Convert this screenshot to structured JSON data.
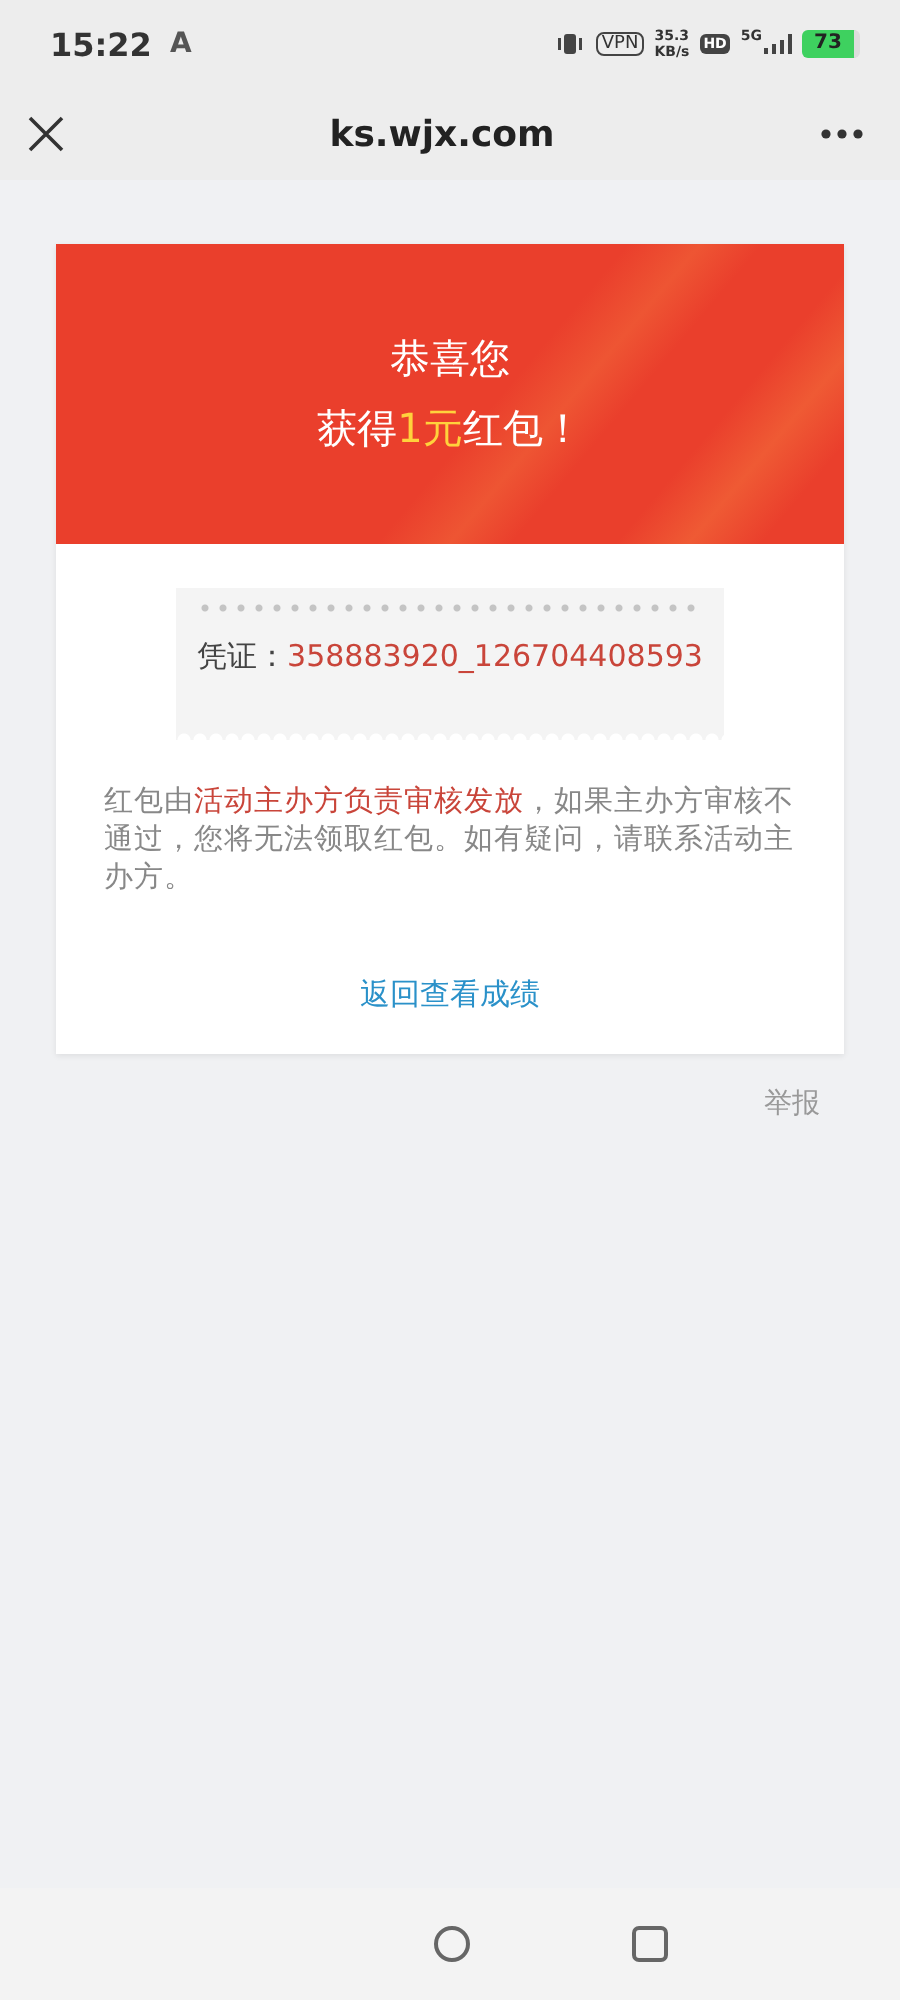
{
  "status_bar": {
    "time": "15:22",
    "app_glyph": "A",
    "vpn": "VPN",
    "speed": "35.3",
    "speed_unit": "KB/s",
    "hd": "HD",
    "network": "5G",
    "battery": "73"
  },
  "header": {
    "title": "ks.wjx.com"
  },
  "banner": {
    "line_1": "恭喜您",
    "line_2": [
      {
        "text": "获得",
        "highlight": false
      },
      {
        "text": "1元",
        "highlight": true
      },
      {
        "text": "红包！",
        "highlight": false
      }
    ]
  },
  "voucher": {
    "label": "凭证：",
    "value": "358883920_126704408593"
  },
  "notice": [
    {
      "text": "红包由",
      "highlight": false
    },
    {
      "text": "活动主办方负责审核发放",
      "highlight": true
    },
    {
      "text": "，如果主办方审核不通过，您将无法领取红包。如有疑问，请联系活动主办方。",
      "highlight": false
    }
  ],
  "link": "返回查看成绩",
  "report": "举报"
}
